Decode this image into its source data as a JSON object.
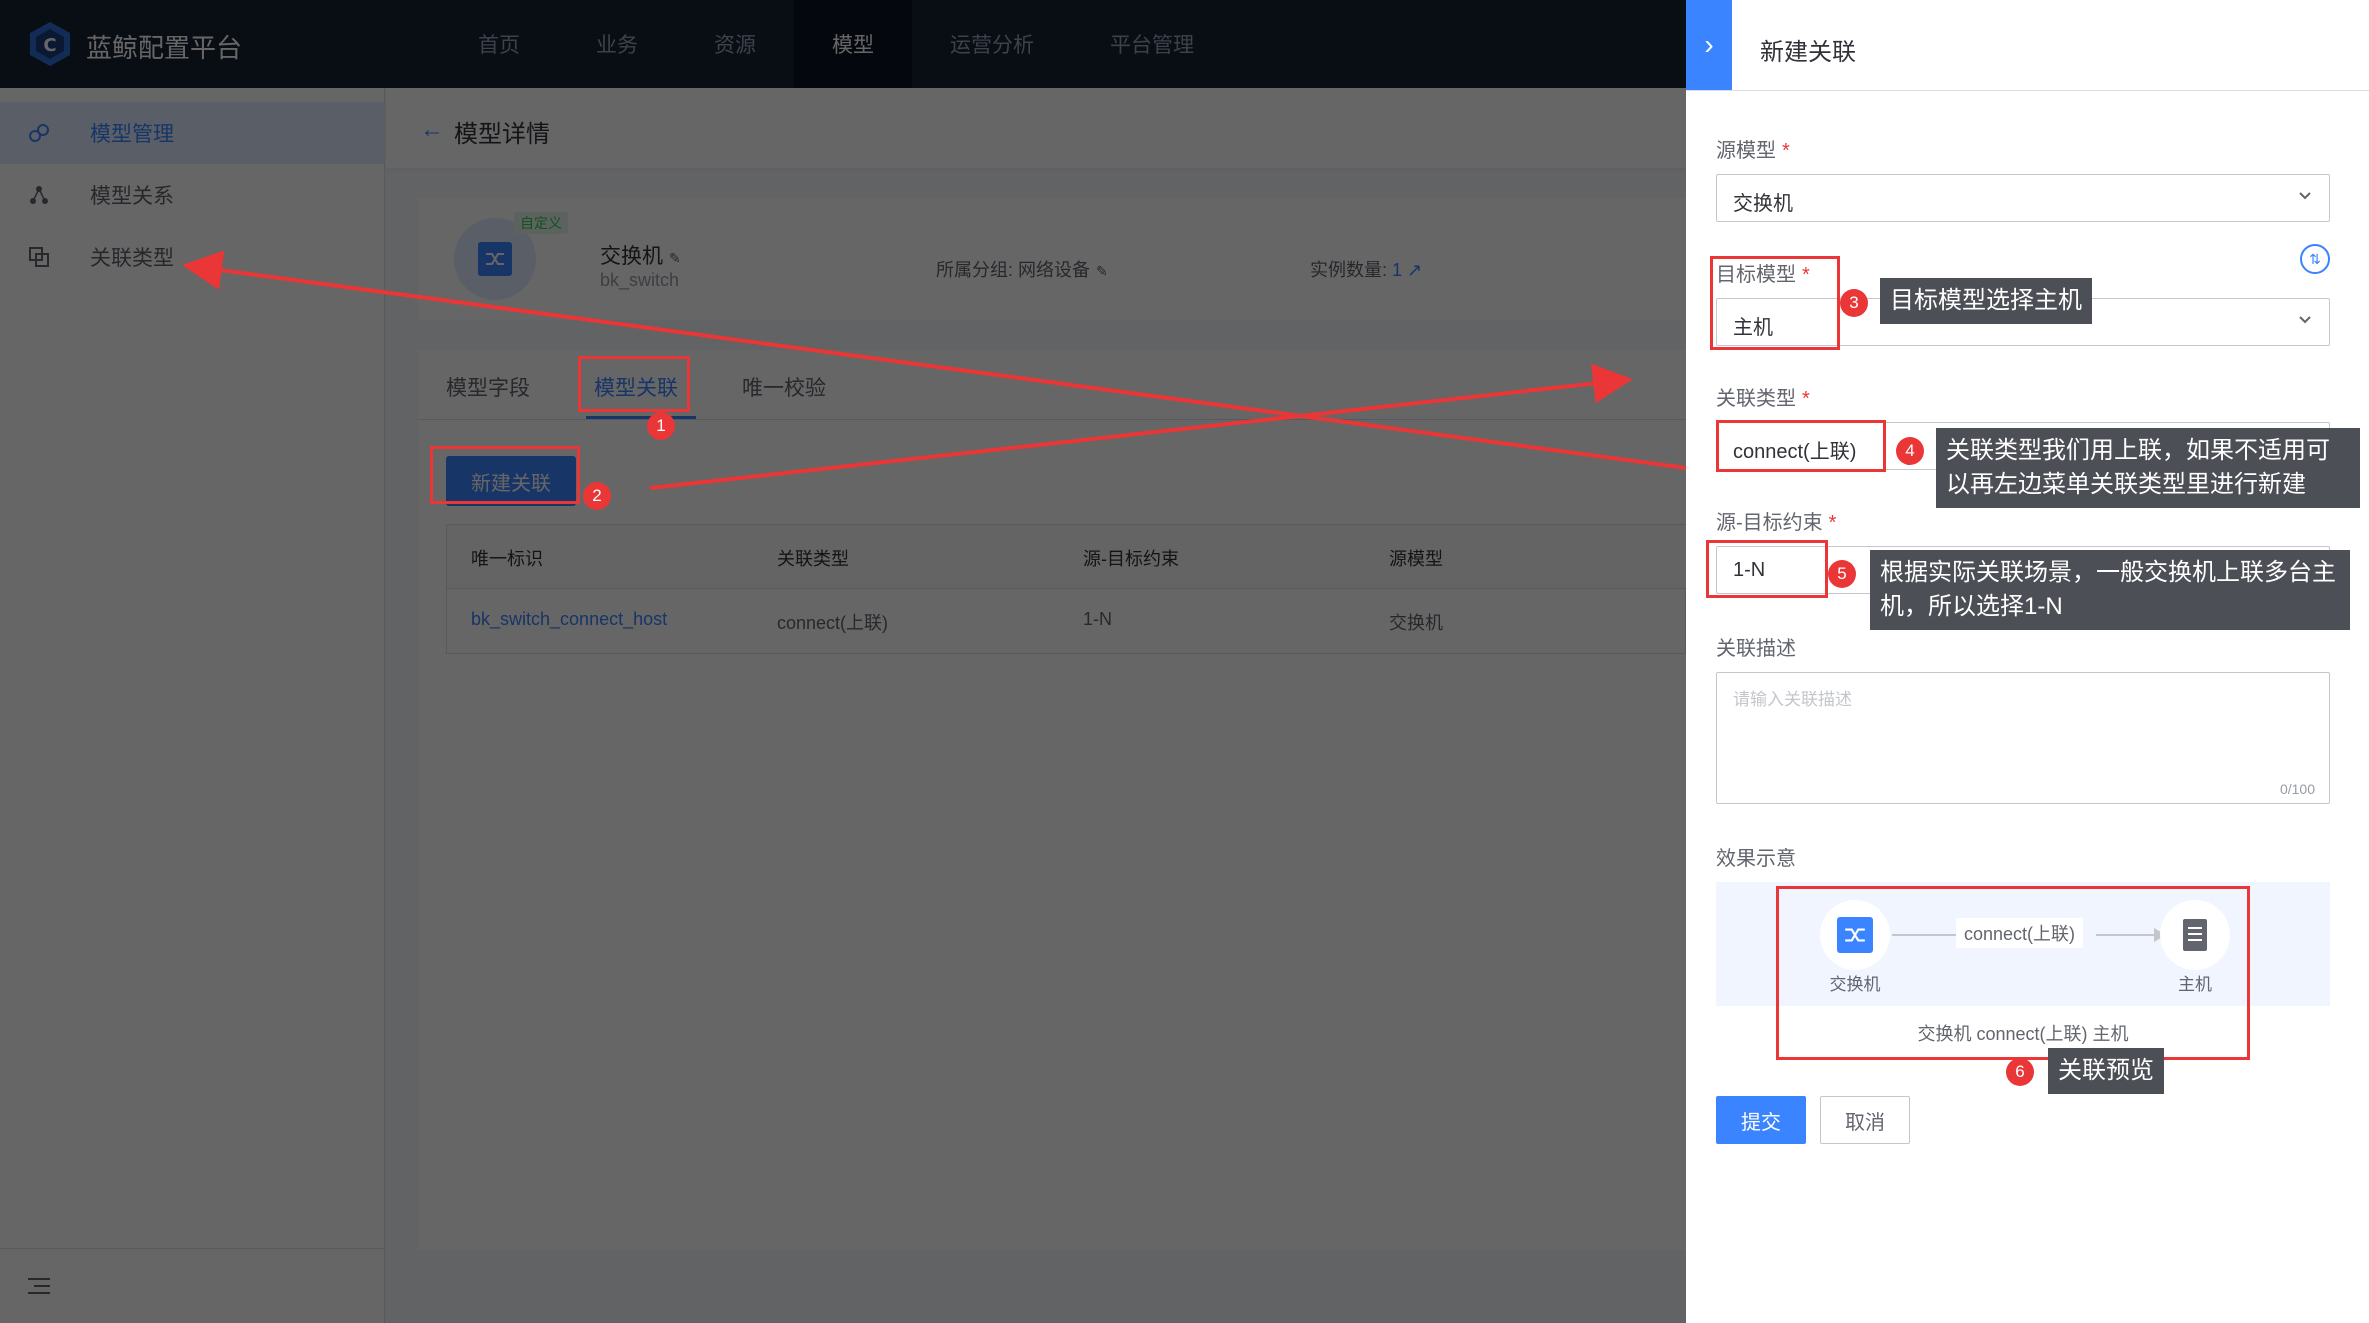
{
  "brand": {
    "name": "蓝鲸配置平台"
  },
  "nav": [
    {
      "label": "首页"
    },
    {
      "label": "业务"
    },
    {
      "label": "资源"
    },
    {
      "label": "模型"
    },
    {
      "label": "运营分析"
    },
    {
      "label": "平台管理"
    }
  ],
  "sidebar": {
    "items": [
      {
        "label": "模型管理"
      },
      {
        "label": "模型关系"
      },
      {
        "label": "关联类型"
      }
    ]
  },
  "page": {
    "title": "模型详情",
    "model": {
      "badge": "自定义",
      "name": "交换机",
      "id": "bk_switch",
      "group_label": "所属分组:",
      "group_value": "网络设备",
      "instance_label": "实例数量:",
      "instance_value": "1"
    },
    "tabs": [
      {
        "label": "模型字段"
      },
      {
        "label": "模型关联"
      },
      {
        "label": "唯一校验"
      }
    ],
    "new_button": "新建关联",
    "table": {
      "headers": [
        "唯一标识",
        "关联类型",
        "源-目标约束",
        "源模型"
      ],
      "rows": [
        [
          "bk_switch_connect_host",
          "connect(上联)",
          "1-N",
          "交换机"
        ]
      ]
    }
  },
  "panel": {
    "title": "新建关联",
    "source_label": "源模型",
    "source_value": "交换机",
    "target_label": "目标模型",
    "target_value": "主机",
    "type_label": "关联类型",
    "type_value": "connect(上联)",
    "constraint_label": "源-目标约束",
    "constraint_value": "1-N",
    "desc_label": "关联描述",
    "desc_placeholder": "请输入关联描述",
    "desc_count": "0/100",
    "preview_label": "效果示意",
    "preview": {
      "source_name": "交换机",
      "target_name": "主机",
      "relation": "connect(上联)",
      "caption": "交换机 connect(上联) 主机"
    },
    "submit": "提交",
    "cancel": "取消"
  },
  "annotations": [
    {
      "num": "1"
    },
    {
      "num": "2"
    },
    {
      "num": "3",
      "text": "目标模型选择主机"
    },
    {
      "num": "4",
      "text": "关联类型我们用上联，如果不适用可以再左边菜单关联类型里进行新建"
    },
    {
      "num": "5",
      "text": "根据实际关联场景，一般交换机上联多台主机，所以选择1-N"
    },
    {
      "num": "6",
      "text": "关联预览"
    }
  ],
  "colors": {
    "primary": "#3a84ff",
    "annotation": "#ea3636",
    "topbar": "#182132"
  }
}
